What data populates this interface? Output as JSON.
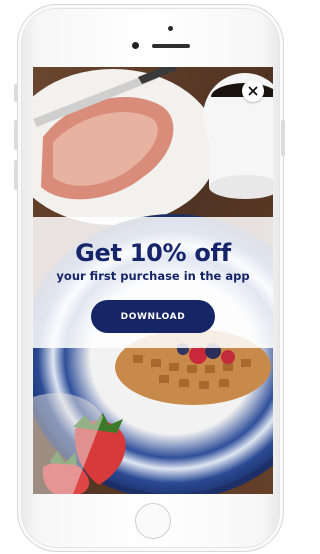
{
  "promo": {
    "title": "Get 10% off",
    "subtitle": "your first purchase in the  app",
    "button_label": "DOWNLOAD"
  },
  "icons": {
    "close": "close-icon"
  },
  "colors": {
    "primary_navy": "#162566",
    "text_navy": "#16256a",
    "overlay_white": "rgba(255,255,255,0.86)"
  }
}
